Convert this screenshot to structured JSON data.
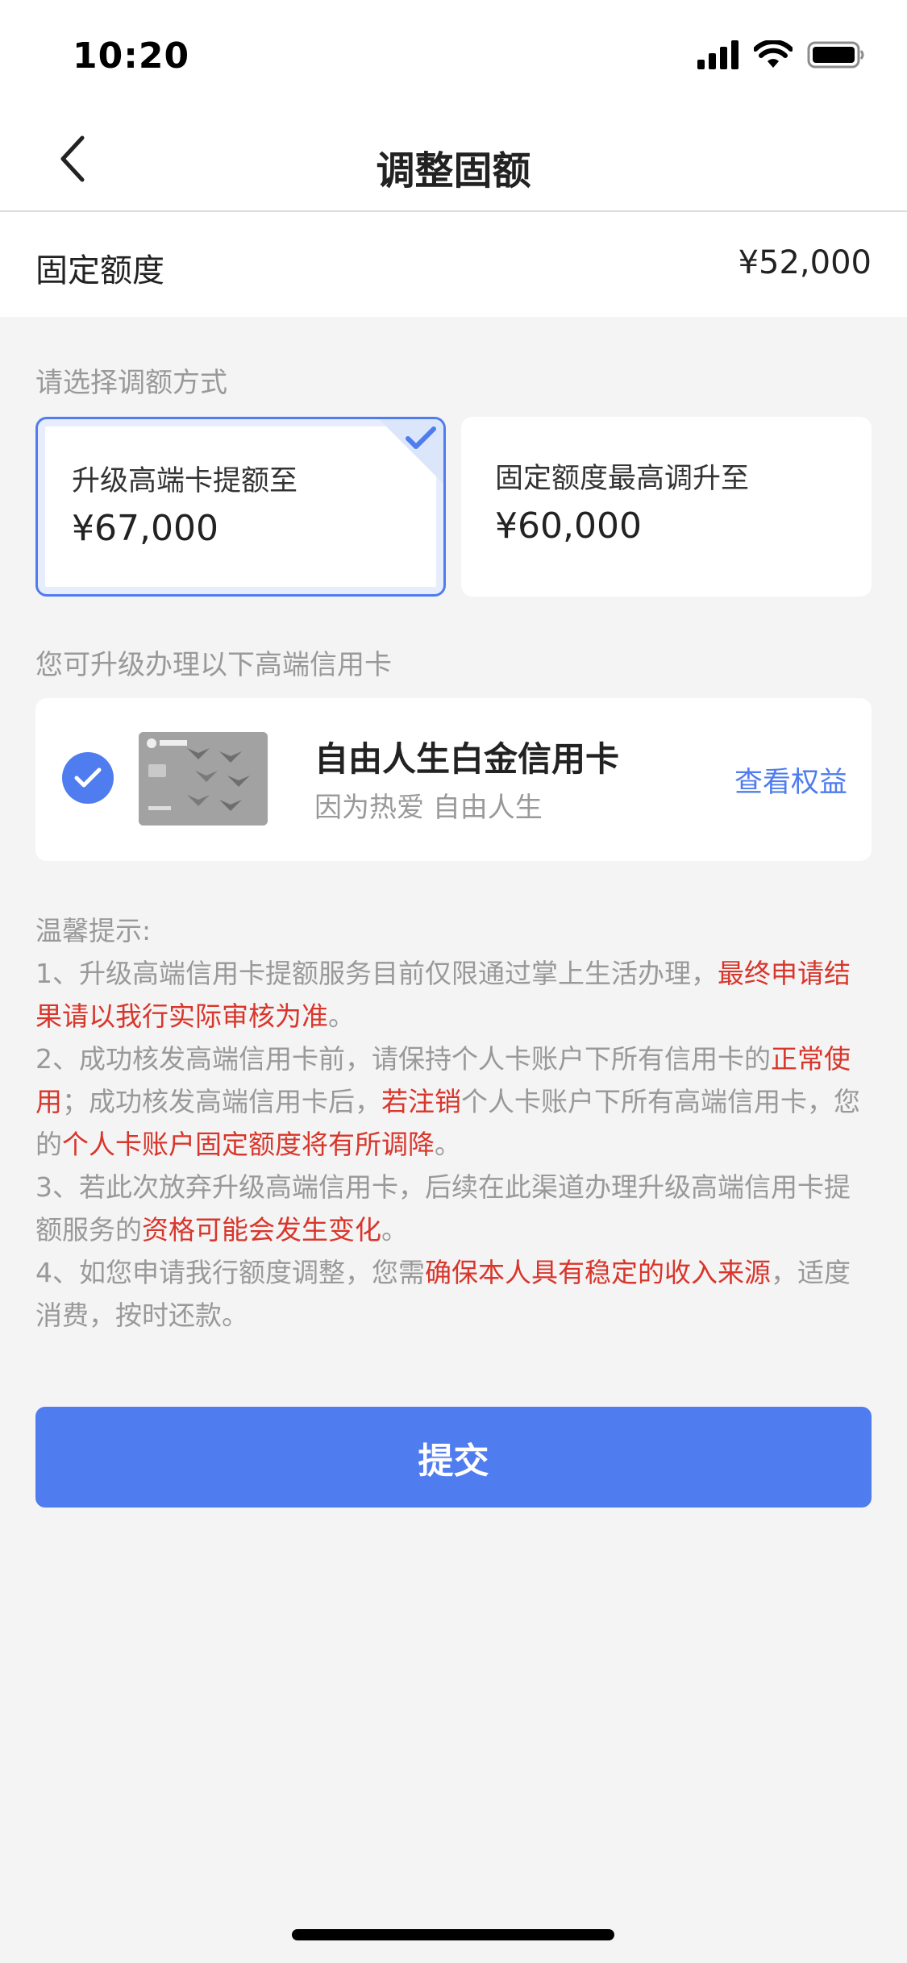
{
  "status_bar": {
    "time": "10:20",
    "icons": [
      "cellular-signal-icon",
      "wifi-icon",
      "battery-icon"
    ]
  },
  "nav": {
    "back_icon": "chevron-left-icon",
    "title": "调整固额"
  },
  "fixed_limit": {
    "label": "固定额度",
    "value": "¥52,000"
  },
  "adjust_section": {
    "title": "请选择调额方式",
    "options": [
      {
        "label": "升级高端卡提额至",
        "value": "¥67,000",
        "selected": true
      },
      {
        "label": "固定额度最高调升至",
        "value": "¥60,000",
        "selected": false
      }
    ]
  },
  "card_section": {
    "title": "您可升级办理以下高端信用卡",
    "card": {
      "name": "自由人生白金信用卡",
      "slogan": "因为热爱 自由人生",
      "link": "查看权益",
      "checked": true
    }
  },
  "tips": {
    "heading": "温馨提示:",
    "items": [
      {
        "parts": [
          {
            "text": "1、升级高端信用卡提额服务目前仅限通过掌上生活办理，",
            "red": false
          },
          {
            "text": "最终申请结果请以我行实际审核为准",
            "red": true
          },
          {
            "text": "。",
            "red": false
          }
        ]
      },
      {
        "parts": [
          {
            "text": "2、成功核发高端信用卡前，请保持个人卡账户下所有信用卡的",
            "red": false
          },
          {
            "text": "正常使用",
            "red": true
          },
          {
            "text": "；成功核发高端信用卡后，",
            "red": false
          },
          {
            "text": "若注销",
            "red": true
          },
          {
            "text": "个人卡账户下所有高端信用卡，您的",
            "red": false
          },
          {
            "text": "个人卡账户固定额度将有所调降",
            "red": true
          },
          {
            "text": "。",
            "red": false
          }
        ]
      },
      {
        "parts": [
          {
            "text": "3、若此次放弃升级高端信用卡，后续在此渠道办理升级高端信用卡提额服务的",
            "red": false
          },
          {
            "text": "资格可能会发生变化",
            "red": true
          },
          {
            "text": "。",
            "red": false
          }
        ]
      },
      {
        "parts": [
          {
            "text": "4、如您申请我行额度调整，您需",
            "red": false
          },
          {
            "text": "确保本人具有稳定的收入来源",
            "red": true
          },
          {
            "text": "，适度消费，按时还款。",
            "red": false
          }
        ]
      }
    ]
  },
  "submit": {
    "label": "提交"
  },
  "colors": {
    "accent": "#4f7cee",
    "warning_text": "#d9362b",
    "muted_text": "#999999",
    "background": "#f4f4f5"
  }
}
